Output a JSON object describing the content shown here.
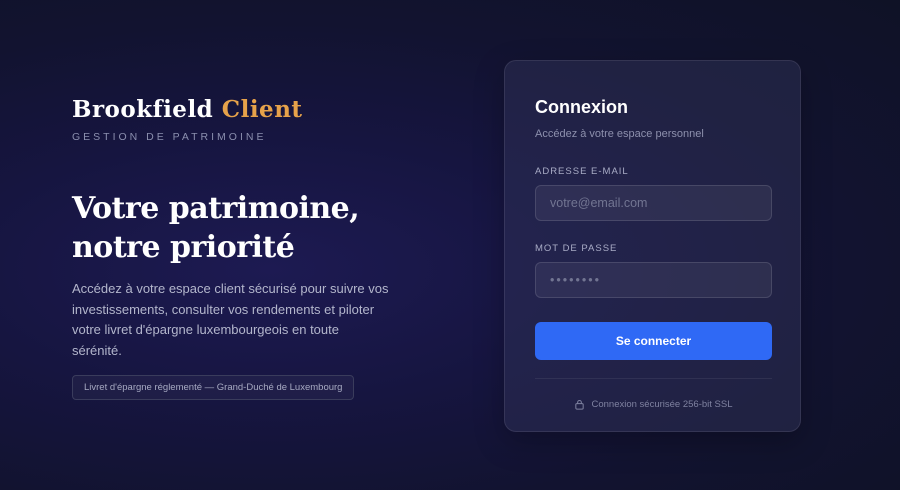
{
  "brand": {
    "name": "Brookfield",
    "name_accent": "Client",
    "tagline": "GESTION DE PATRIMOINE"
  },
  "hero": {
    "headline": "Votre patrimoine,\nnotre priorité",
    "description": "Accédez à votre espace client sécurisé pour suivre vos investissements, consulter vos rendements et piloter votre livret d'épargne luxembourgeois en toute sérénité.",
    "badge": "Livret d'épargne réglementé — Grand-Duché de Luxembourg"
  },
  "login": {
    "title": "Connexion",
    "subtitle": "Accédez à votre espace personnel",
    "email_label": "ADRESSE E-MAIL",
    "email_placeholder": "votre@email.com",
    "email_value": "",
    "password_label": "MOT DE PASSE",
    "password_placeholder": "••••••••",
    "password_value": "",
    "submit_label": "Se connecter",
    "secure_note": "Connexion sécurisée 256-bit SSL",
    "secure_icon": "lock-icon"
  },
  "colors": {
    "accent": "#e6a24a",
    "primary_button": "#2f69f5"
  }
}
